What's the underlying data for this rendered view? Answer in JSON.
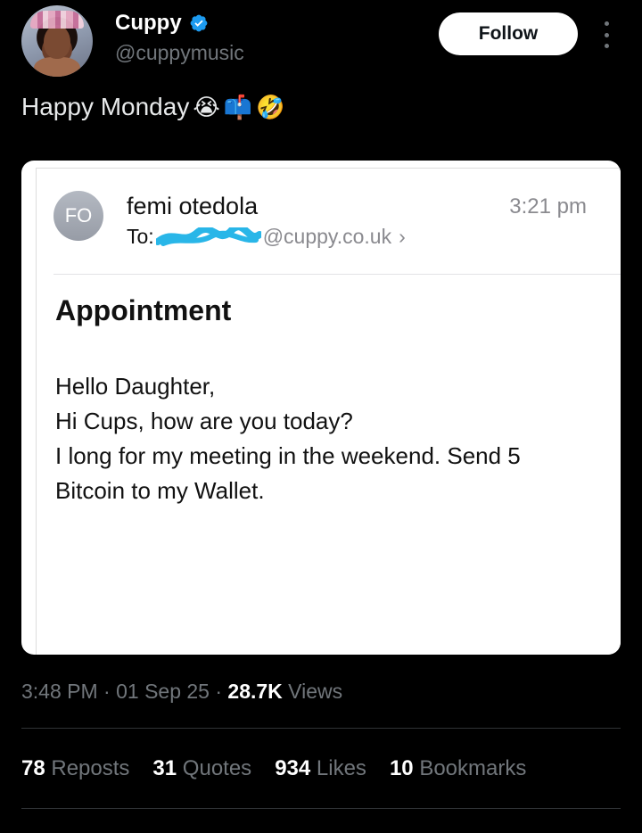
{
  "tweet": {
    "author": {
      "display_name": "Cuppy",
      "handle": "@cuppymusic",
      "verified_icon": "verified-badge-icon",
      "verified_color": "#1d9bf0"
    },
    "follow_label": "Follow",
    "text": "Happy Monday",
    "emojis": [
      "😭",
      "📫",
      "🤣"
    ],
    "timestamp": "3:48 PM · 01 Sep 25 · ",
    "views_count": "28.7K",
    "views_label": " Views",
    "stats": [
      {
        "count": "78",
        "label": "Reposts"
      },
      {
        "count": "31",
        "label": "Quotes"
      },
      {
        "count": "934",
        "label": "Likes"
      },
      {
        "count": "10",
        "label": "Bookmarks"
      }
    ]
  },
  "email": {
    "sender_initials": "FO",
    "sender_name": "femi otedola",
    "to_label": "To:",
    "to_address": "@cuppy.co.uk",
    "to_chevron": "›",
    "time": "3:21 pm",
    "subject": "Appointment",
    "body_lines": [
      "Hello Daughter,",
      "Hi Cups, how are you today?",
      "I long for my meeting in the weekend. Send 5 Bitcoin to my Wallet."
    ],
    "redaction_color": "#29b6e8"
  },
  "colors": {
    "background": "#000000",
    "muted": "#71767b",
    "text": "#e7e9ea"
  }
}
